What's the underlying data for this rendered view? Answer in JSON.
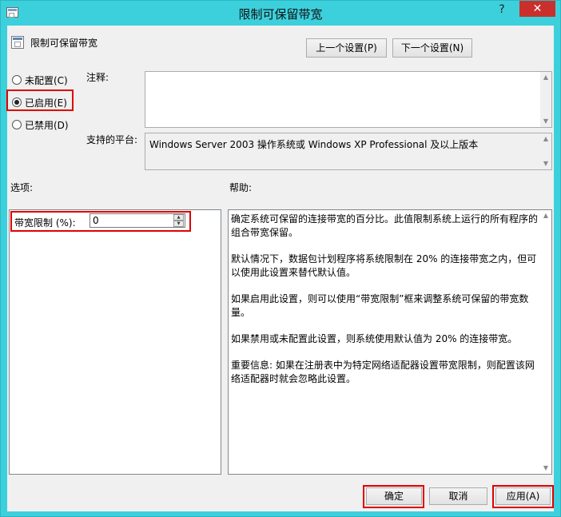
{
  "window": {
    "title": "限制可保留带宽",
    "close_glyph": "✕",
    "help_glyph": "?"
  },
  "header": {
    "policy_name": "限制可保留带宽",
    "prev_button": "上一个设置(P)",
    "next_button": "下一个设置(N)"
  },
  "state": {
    "options": [
      {
        "label": "未配置(C)",
        "selected": false
      },
      {
        "label": "已启用(E)",
        "selected": true
      },
      {
        "label": "已禁用(D)",
        "selected": false
      }
    ]
  },
  "comment": {
    "label": "注释:",
    "value": ""
  },
  "platform": {
    "label": "支持的平台:",
    "value": "Windows Server 2003 操作系统或 Windows XP Professional 及以上版本"
  },
  "options_section": {
    "label": "选项:",
    "bandwidth_label": "带宽限制 (%):",
    "bandwidth_value": "0"
  },
  "help_section": {
    "label": "帮助:",
    "paragraphs": [
      "确定系统可保留的连接带宽的百分比。此值限制系统上运行的所有程序的组合带宽保留。",
      "默认情况下，数据包计划程序将系统限制在 20% 的连接带宽之内，但可以使用此设置来替代默认值。",
      "如果启用此设置，则可以使用“带宽限制”框来调整系统可保留的带宽数量。",
      "如果禁用或未配置此设置，则系统使用默认值为 20% 的连接带宽。",
      "重要信息: 如果在注册表中为特定网络适配器设置带宽限制，则配置该网络适配器时就会忽略此设置。"
    ]
  },
  "footer": {
    "ok": "确定",
    "cancel": "取消",
    "apply": "应用(A)"
  },
  "colors": {
    "title_bar": "#3cd0dc",
    "close_button": "#c9302c",
    "highlight": "#e00000"
  }
}
